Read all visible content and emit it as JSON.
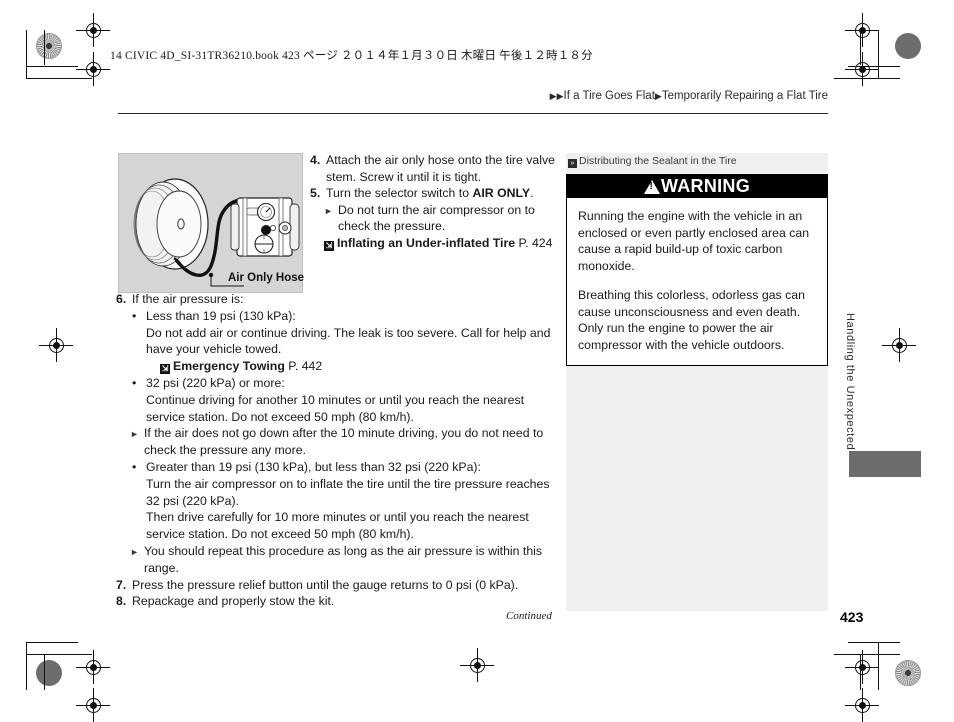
{
  "print_marks": {
    "book_tag": "14 CIVIC 4D_SI-31TR36210.book   423 ページ   ２０１４年１月３０日   木曜日   午後１２時１８分"
  },
  "breadcrumb": {
    "marker": "▶▶",
    "level1": "If a Tire Goes Flat",
    "separator": "▶",
    "level2": "Temporarily Repairing a Flat Tire"
  },
  "figure": {
    "caption": "Air Only Hose",
    "alt": "tire-and-air-compressor-illustration"
  },
  "steps_right": [
    {
      "num": "4.",
      "text_before": "Attach the air only hose onto the tire valve stem. Screw it until it is tight."
    },
    {
      "num": "5.",
      "text_before": "Turn the selector switch to ",
      "bold": "AIR ONLY",
      "text_after": ".",
      "sub": "Do not turn the air compressor on to check the pressure.",
      "xref_title": "Inflating an Under-inflated Tire",
      "xref_page": "P. 424"
    }
  ],
  "steps_main": {
    "step6": {
      "num": "6.",
      "lead": "If the air pressure is:",
      "bullets": [
        {
          "title": "Less than 19 psi (130 kPa):",
          "body": "Do not add air or continue driving. The leak is too severe. Call for help and have your vehicle towed.",
          "xref_title": "Emergency Towing",
          "xref_page": "P. 442"
        },
        {
          "title": "32 psi (220 kPa) or more:",
          "body": "Continue driving for another 10 minutes or until you reach the nearest service station. Do not exceed 50 mph (80 km/h).",
          "note": "If the air does not go down after the 10 minute driving, you do not need to check the pressure any more."
        },
        {
          "title": "Greater than 19 psi (130 kPa), but less than 32 psi (220 kPa):",
          "body": "Turn the air compressor on to inflate the tire until the tire pressure reaches 32 psi (220 kPa).",
          "body2": "Then drive carefully for 10 more minutes or until you reach the nearest service station. Do not exceed 50 mph (80 km/h).",
          "note": "You should repeat this procedure as long as the air pressure is within this range."
        }
      ]
    },
    "step7": {
      "num": "7.",
      "text": "Press the pressure relief button until the gauge returns to 0 psi (0 kPa)."
    },
    "step8": {
      "num": "8.",
      "text": "Repackage and properly stow the kit."
    }
  },
  "sidebar": {
    "title": "Distributing the Sealant in the Tire",
    "warning_label": "WARNING",
    "paragraphs": [
      "Running the engine with the vehicle in an enclosed or even partly enclosed area can cause a rapid build-up of toxic carbon monoxide.",
      "Breathing this colorless, odorless gas can cause unconsciousness and even death. Only run the engine to power the air compressor with the vehicle outdoors."
    ]
  },
  "section_tab": "Handling the Unexpected",
  "footer": {
    "continued": "Continued",
    "page_number": "423"
  },
  "colors": {
    "warning_bar_bg": "#000000",
    "sidebar_bg": "#f0f0f0",
    "figure_bg": "#d5d5d5",
    "tab_block": "#6d6d6d"
  }
}
